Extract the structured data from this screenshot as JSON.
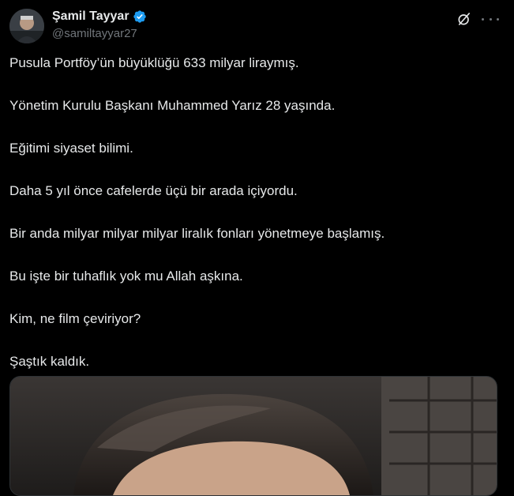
{
  "author": {
    "display_name": "Şamil Tayyar",
    "handle": "@samiltayyar27",
    "verified": true,
    "verified_color": "#1d9bf0"
  },
  "icons": {
    "grok": "grok-icon",
    "more": "more-icon"
  },
  "tweet": {
    "paragraphs": [
      "Pusula Portföy’ün büyüklüğü 633 milyar liraymış.",
      "Yönetim Kurulu Başkanı Muhammed Yarız 28 yaşında.",
      "Eğitimi siyaset bilimi.",
      "Daha 5 yıl önce cafelerde üçü bir arada içiyordu.",
      "Bir anda milyar milyar milyar liralık fonları yönetmeye başlamış.",
      "Bu işte bir tuhaflık yok mu Allah aşkına.",
      "Kim, ne film çeviriyor?",
      "Şaştık kaldık."
    ]
  },
  "colors": {
    "background": "#000000",
    "text": "#e7e9ea",
    "muted": "#71767b"
  }
}
